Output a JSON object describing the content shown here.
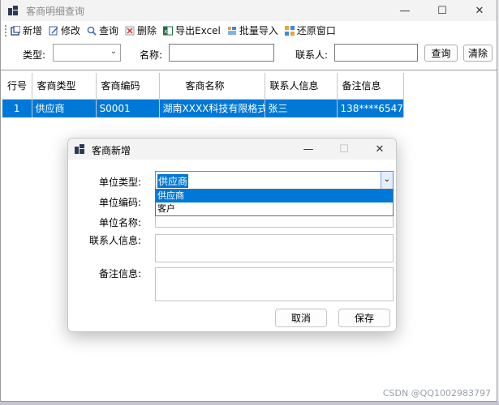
{
  "window": {
    "title": "客商明细查询",
    "minimize": "—",
    "maximize": "☐",
    "close": "✕"
  },
  "toolbar": {
    "items": [
      {
        "label": "新增"
      },
      {
        "label": "修改"
      },
      {
        "label": "查询"
      },
      {
        "label": "删除"
      },
      {
        "label": "导出Excel"
      },
      {
        "label": "批量导入"
      },
      {
        "label": "还原窗口"
      }
    ]
  },
  "filters": {
    "type_label": "类型:",
    "type_value": "",
    "name_label": "名称:",
    "name_value": "",
    "contact_label": "联系人:",
    "contact_value": "",
    "query_button": "查询",
    "clear_button": "清除"
  },
  "grid": {
    "columns": [
      "行号",
      "客商类型",
      "客商编码",
      "客商名称",
      "联系人信息",
      "备注信息"
    ],
    "rows": [
      [
        "1",
        "供应商",
        "S0001",
        "湖南XXXX科技有限格式",
        "张三",
        "138****6547"
      ]
    ]
  },
  "dialog": {
    "title": "客商新增",
    "minimize": "—",
    "maximize": "☐",
    "close": "✕",
    "unit_type_label": "单位类型:",
    "unit_type_value": "供应商",
    "unit_code_label": "单位编码:",
    "unit_name_label": "单位名称:",
    "contact_label": "联系人信息:",
    "remark_label": "备注信息:",
    "dropdown_options": [
      "供应商",
      "客户"
    ],
    "cancel_button": "取消",
    "save_button": "保存"
  },
  "watermark": "CSDN @QQ1002983797",
  "colors": {
    "selection": "#0078d7",
    "titlebar": "#f3f3f3"
  }
}
